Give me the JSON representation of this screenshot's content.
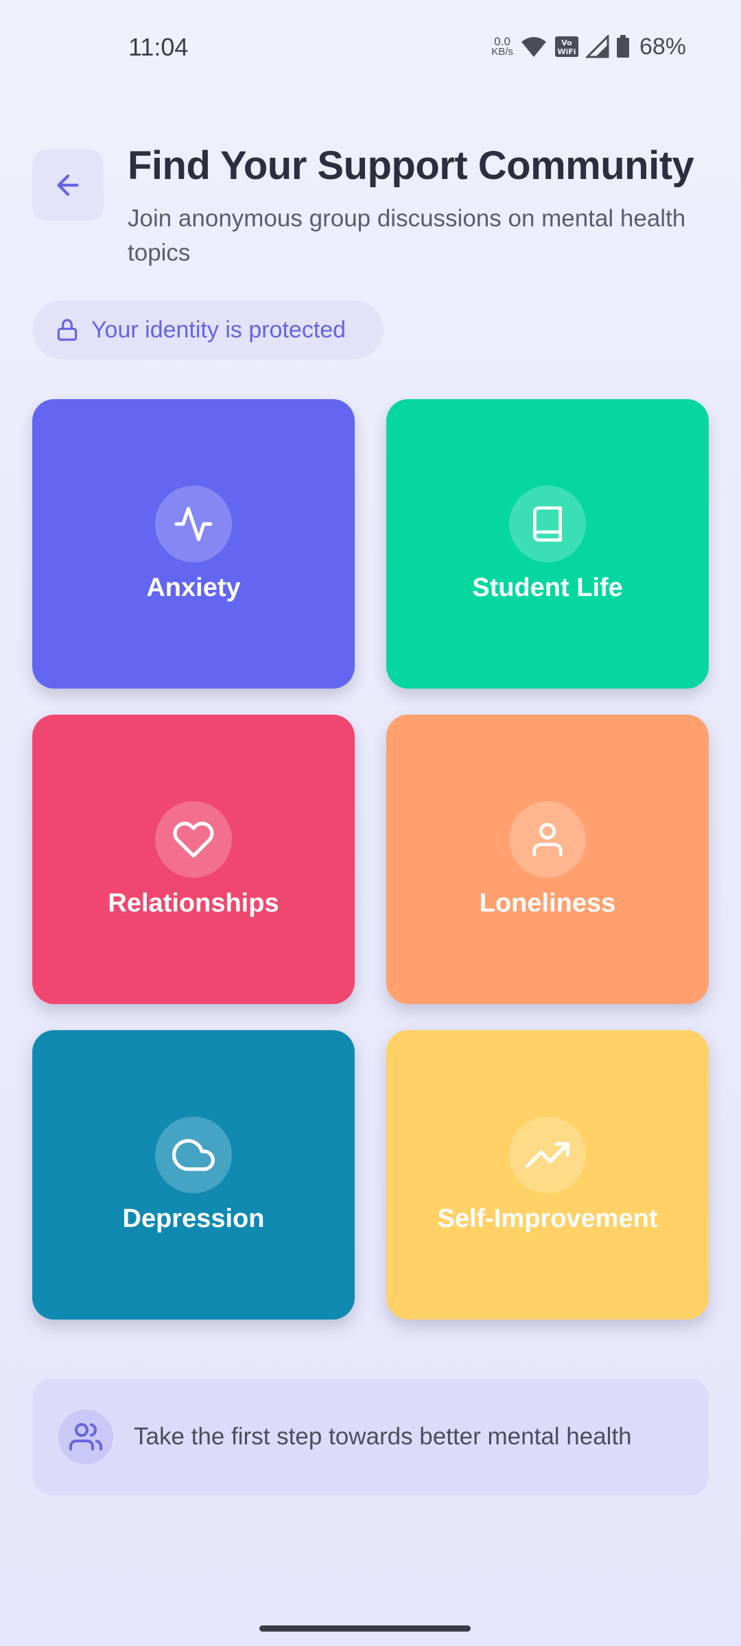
{
  "status_bar": {
    "time": "11:04",
    "net_speed_value": "0.0",
    "net_speed_unit": "KB/s",
    "vowifi_top": "Vo",
    "vowifi_bottom": "WiFi",
    "battery": "68%"
  },
  "header": {
    "back_icon": "arrow-left-icon",
    "title": "Find Your Support Community",
    "subtitle": "Join anonymous group discussions on mental health topics"
  },
  "privacy_badge": {
    "icon": "lock-icon",
    "label": "Your identity is protected"
  },
  "communities": [
    {
      "label": "Anxiety",
      "icon": "activity-icon",
      "color": "#6366f1"
    },
    {
      "label": "Student Life",
      "icon": "book-icon",
      "color": "#06d6a0"
    },
    {
      "label": "Relationships",
      "icon": "heart-icon",
      "color": "#ef476f"
    },
    {
      "label": "Loneliness",
      "icon": "user-icon",
      "color": "#ffa06e"
    },
    {
      "label": "Depression",
      "icon": "cloud-icon",
      "color": "#118ab2"
    },
    {
      "label": "Self-Improvement",
      "icon": "trending-up-icon",
      "color": "#ffd166"
    }
  ],
  "footer": {
    "icon": "users-icon",
    "text": "Take the first step towards better mental health"
  },
  "colors": {
    "accent": "#6a63e0",
    "background": "#eceefb"
  }
}
